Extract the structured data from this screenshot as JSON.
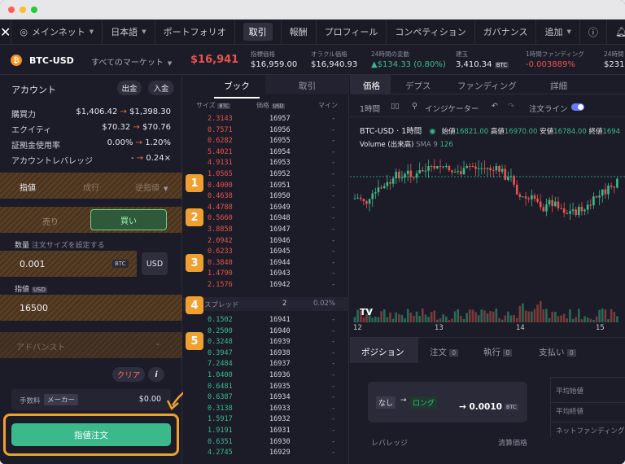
{
  "nav": {
    "network": "メインネット",
    "language": "日本語",
    "portfolio": "ポートフォリオ",
    "trade": "取引",
    "rewards": "報酬",
    "profile": "プロフィール",
    "competition": "コンペティション",
    "governance": "ガバナンス",
    "more": "追加"
  },
  "ticker": {
    "pair": "BTC-USD",
    "markets": "すべてのマーケット",
    "price": "$16,941",
    "index_label": "指標価格",
    "index_value": "$16,959.00",
    "oracle_label": "オラクル価格",
    "oracle_value": "$16,940.93",
    "change_label": "24時間の変動",
    "change_value": "▲$134.33 (0.80%)",
    "oi_label": "建玉",
    "oi_value": "3,410.34",
    "oi_unit": "BTC",
    "funding_label": "1時間ファンディング",
    "funding_value": "-0.003889%",
    "vol_label": "24時間",
    "vol_value": "$231,"
  },
  "account": {
    "title": "アカウント",
    "withdraw": "出金",
    "deposit": "入金",
    "rows": [
      {
        "label": "購買力",
        "value": "$1,406.42",
        "arrow": "→",
        "next": "$1,398.30"
      },
      {
        "label": "エクイティ",
        "value": "$70.32",
        "arrow": "→",
        "next": "$70.76"
      },
      {
        "label": "証拠金使用率",
        "value": "0.00%",
        "arrow": "→",
        "next": "1.20%"
      },
      {
        "label": "アカウントレバレッジ",
        "value": "-",
        "arrow": "→",
        "next": "0.24×"
      }
    ]
  },
  "order": {
    "type_limit": "指値",
    "type_market": "成行",
    "type_stop": "逆指値",
    "sell": "売り",
    "buy": "買い",
    "size_label": "数量",
    "size_hint": "注文サイズを設定する",
    "size_value": "0.001",
    "size_unit": "BTC",
    "usd_unit": "USD",
    "price_label": "指値",
    "price_unit": "USD",
    "price_value": "16500",
    "advanced": "アドバンスト",
    "clear": "クリア",
    "info": "i",
    "fee_label": "手数料",
    "fee_tier": "メーカー",
    "fee_value": "$0.00",
    "submit": "指値注文"
  },
  "book": {
    "tab_book": "ブック",
    "tab_trades": "取引",
    "col_size": "サイズ",
    "col_size_unit": "BTC",
    "col_price": "価格",
    "col_price_unit": "USD",
    "col_mine": "マイン",
    "spread_label": "スプレッド",
    "spread_value": "2",
    "spread_pct": "0.02%",
    "asks": [
      [
        "2.3143",
        "16957"
      ],
      [
        "0.7571",
        "16956"
      ],
      [
        "0.6282",
        "16955"
      ],
      [
        "5.4021",
        "16954"
      ],
      [
        "4.9131",
        "16953"
      ],
      [
        "1.0565",
        "16952"
      ],
      [
        "0.4000",
        "16951"
      ],
      [
        "0.4638",
        "16950"
      ],
      [
        "4.4788",
        "16949"
      ],
      [
        "0.5660",
        "16948"
      ],
      [
        "3.8858",
        "16947"
      ],
      [
        "2.0942",
        "16946"
      ],
      [
        "0.6233",
        "16945"
      ],
      [
        "0.3840",
        "16944"
      ],
      [
        "1.4790",
        "16943"
      ],
      [
        "2.1576",
        "16942"
      ]
    ],
    "bids": [
      [
        "0.1502",
        "16941"
      ],
      [
        "0.2500",
        "16940"
      ],
      [
        "0.3248",
        "16939"
      ],
      [
        "0.3947",
        "16938"
      ],
      [
        "7.2484",
        "16937"
      ],
      [
        "1.0400",
        "16936"
      ],
      [
        "0.6481",
        "16935"
      ],
      [
        "0.6387",
        "16934"
      ],
      [
        "0.3138",
        "16933"
      ],
      [
        "1.5917",
        "16932"
      ],
      [
        "1.9191",
        "16931"
      ],
      [
        "0.6351",
        "16930"
      ],
      [
        "4.2745",
        "16929"
      ]
    ],
    "mine": "-"
  },
  "badges": [
    "1",
    "2",
    "3",
    "4",
    "5"
  ],
  "chart": {
    "tabs": [
      "価格",
      "デプス",
      "ファンディング",
      "詳細"
    ],
    "interval": "1時間",
    "indicators": "インジケーター",
    "order_lines": "注文ライン",
    "pair": "BTC-USD",
    "tf": "1時間",
    "ohlc": {
      "o_label": "始値",
      "o": "16821.00",
      "h_label": "高値",
      "h": "16970.00",
      "l_label": "安値",
      "l": "16784.00",
      "c_label": "終値",
      "c": "1694"
    },
    "volume_label": "Volume (出来高)",
    "sma": "SMA 9",
    "sma_value": "126",
    "x_ticks": [
      "12",
      "13",
      "14",
      "15"
    ]
  },
  "positions": {
    "tabs": [
      "ポジション",
      "注文",
      "執行",
      "支払い"
    ],
    "counts": [
      "0",
      "0",
      "0"
    ],
    "from": "なし",
    "to": "ロング",
    "amount": "→ 0.0010",
    "unit": "BTC",
    "leverage": "レバレッジ",
    "liq": "清算価格",
    "right": [
      "平均始値",
      "平均終値",
      "ネットファンディング"
    ]
  },
  "colors": {
    "accent": "#f0a030",
    "green": "#3bb98a",
    "red": "#e8534f",
    "bg": "#1c1c28"
  }
}
